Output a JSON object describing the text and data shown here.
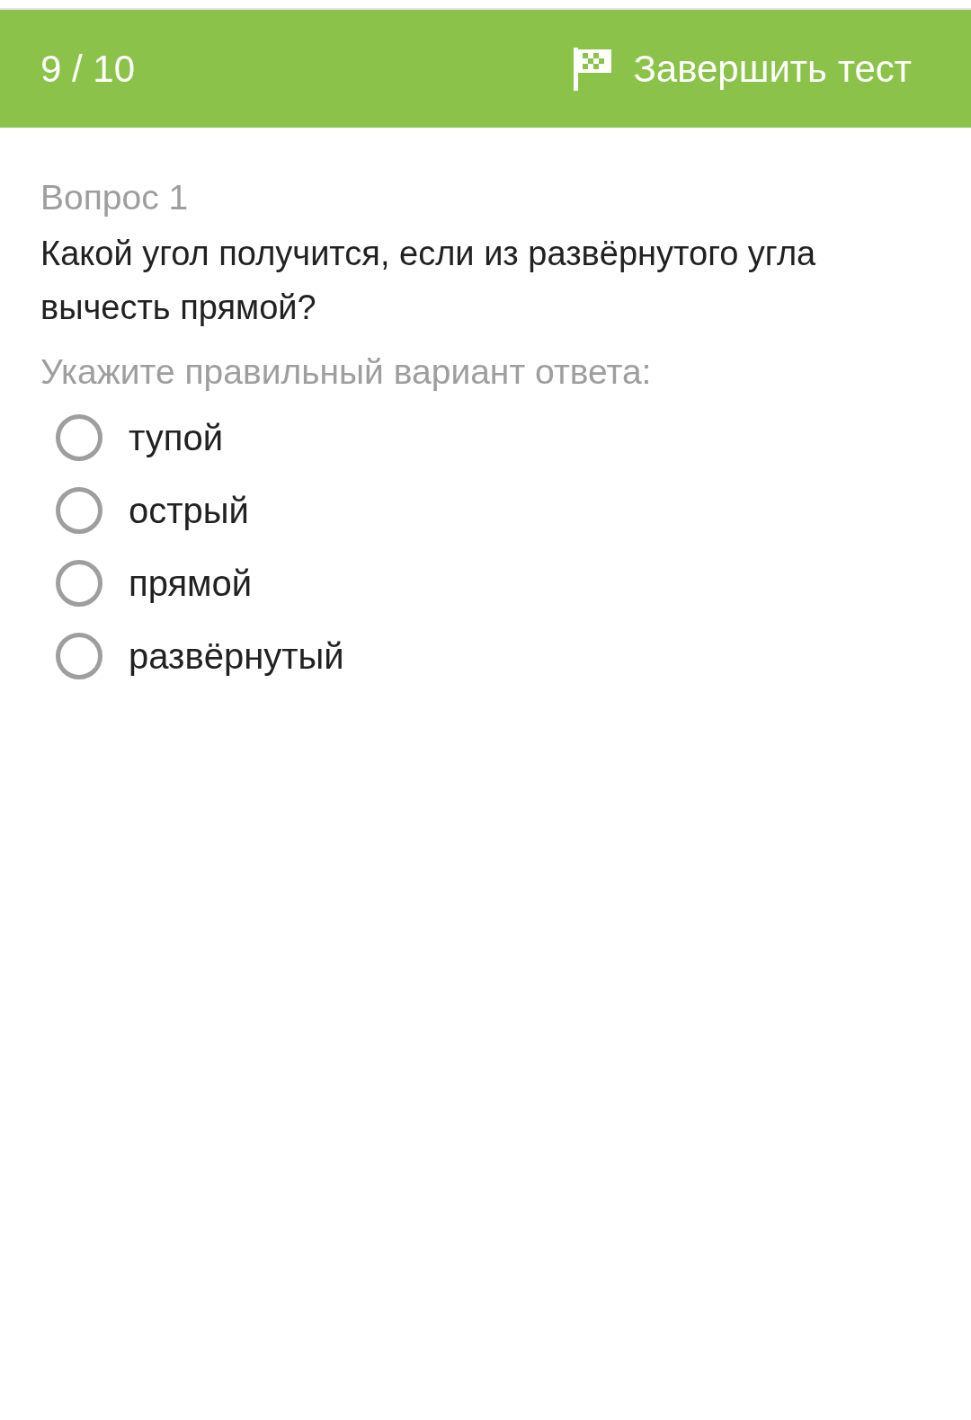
{
  "header": {
    "progress": "9 / 10",
    "finish_button": "Завершить тест"
  },
  "question": {
    "number": "Вопрос 1",
    "text": "Какой угол получится, если из развёрнутого угла вычесть прямой?",
    "instruction": "Укажите правильный вариант ответа:",
    "options": [
      {
        "label": "тупой",
        "selected": false
      },
      {
        "label": "острый",
        "selected": false
      },
      {
        "label": "прямой",
        "selected": false
      },
      {
        "label": "развёрнутый",
        "selected": false
      }
    ]
  }
}
